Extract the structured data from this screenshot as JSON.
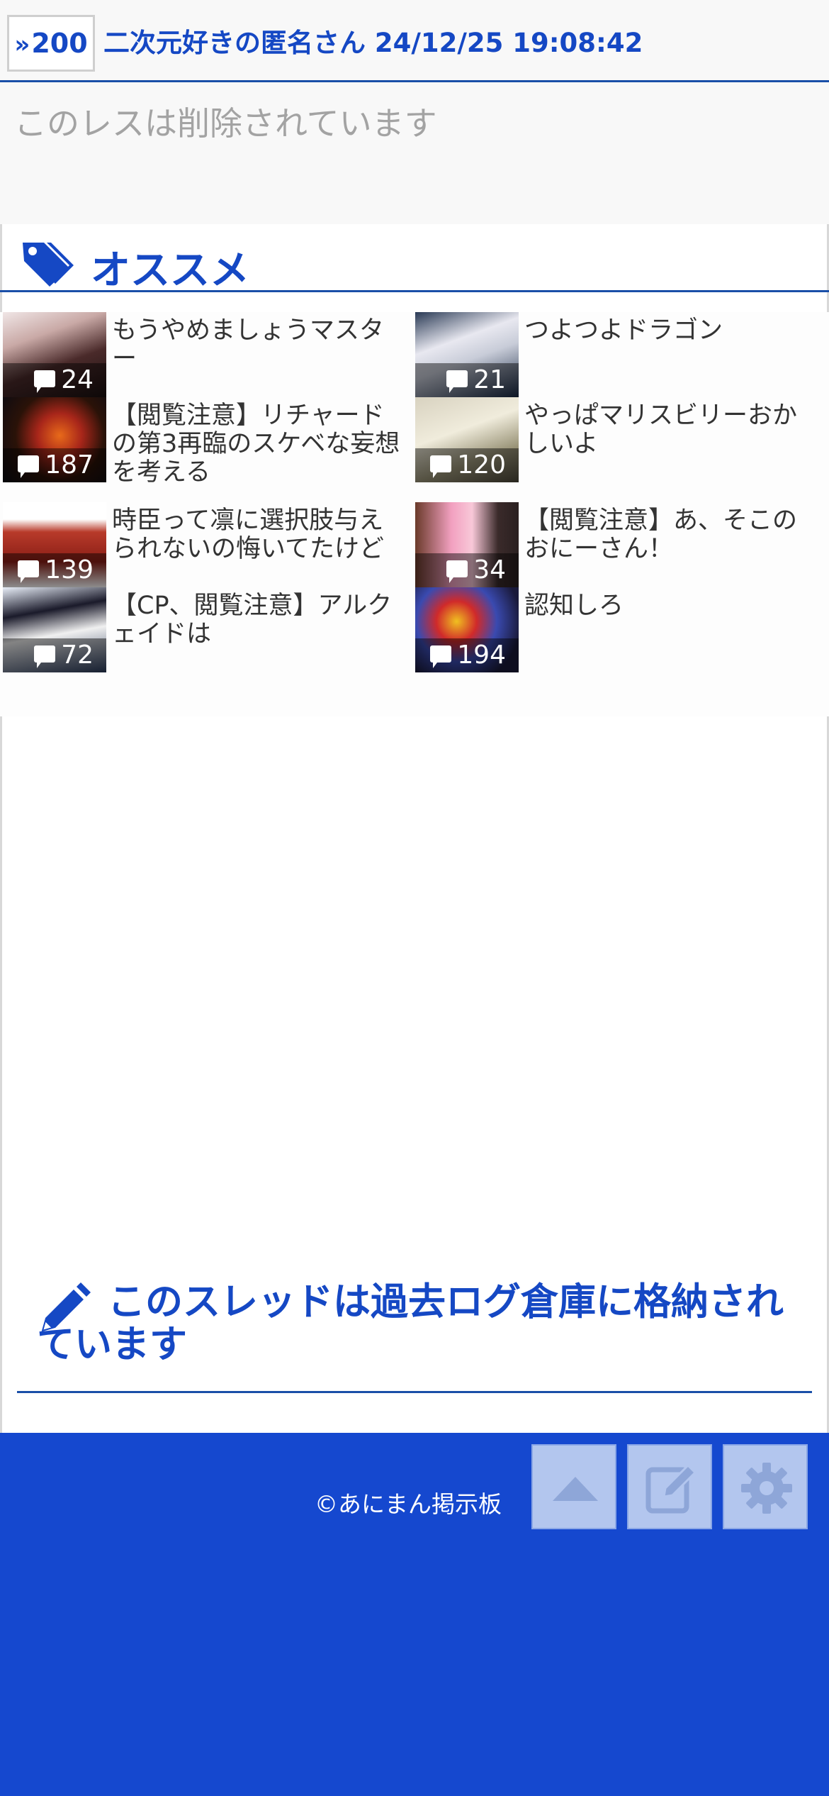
{
  "post": {
    "number": "200",
    "meta": "二次元好きの匿名さん 24/12/25 19:08:42",
    "body": "このレスは削除されています"
  },
  "recommend": {
    "heading": "オススメ",
    "items": [
      {
        "title": "もうやめましょうマスター",
        "count": "24"
      },
      {
        "title": "つよつよドラゴン",
        "count": "21"
      },
      {
        "title": "【閲覧注意】リチャードの第3再臨のスケベな妄想を考える",
        "count": "187"
      },
      {
        "title": "やっぱマリスビリーおかしいよ",
        "count": "120"
      },
      {
        "title": "時臣って凛に選択肢与えられないの悔いてたけど",
        "count": "139"
      },
      {
        "title": "【閲覧注意】あ、そこのおにーさん！",
        "count": "34"
      },
      {
        "title": "【CP、閲覧注意】アルクェイドは",
        "count": "72"
      },
      {
        "title": "認知しろ",
        "count": "194"
      }
    ]
  },
  "archive_notice": "このスレッドは過去ログ倉庫に格納されています",
  "footer": {
    "copyright": "©あにまん掲示板",
    "buttons": [
      "scroll-top",
      "post",
      "settings"
    ]
  },
  "colors": {
    "accent": "#1548c4",
    "footer_bg": "#1548cf",
    "deleted_text": "#a3a3a3"
  }
}
